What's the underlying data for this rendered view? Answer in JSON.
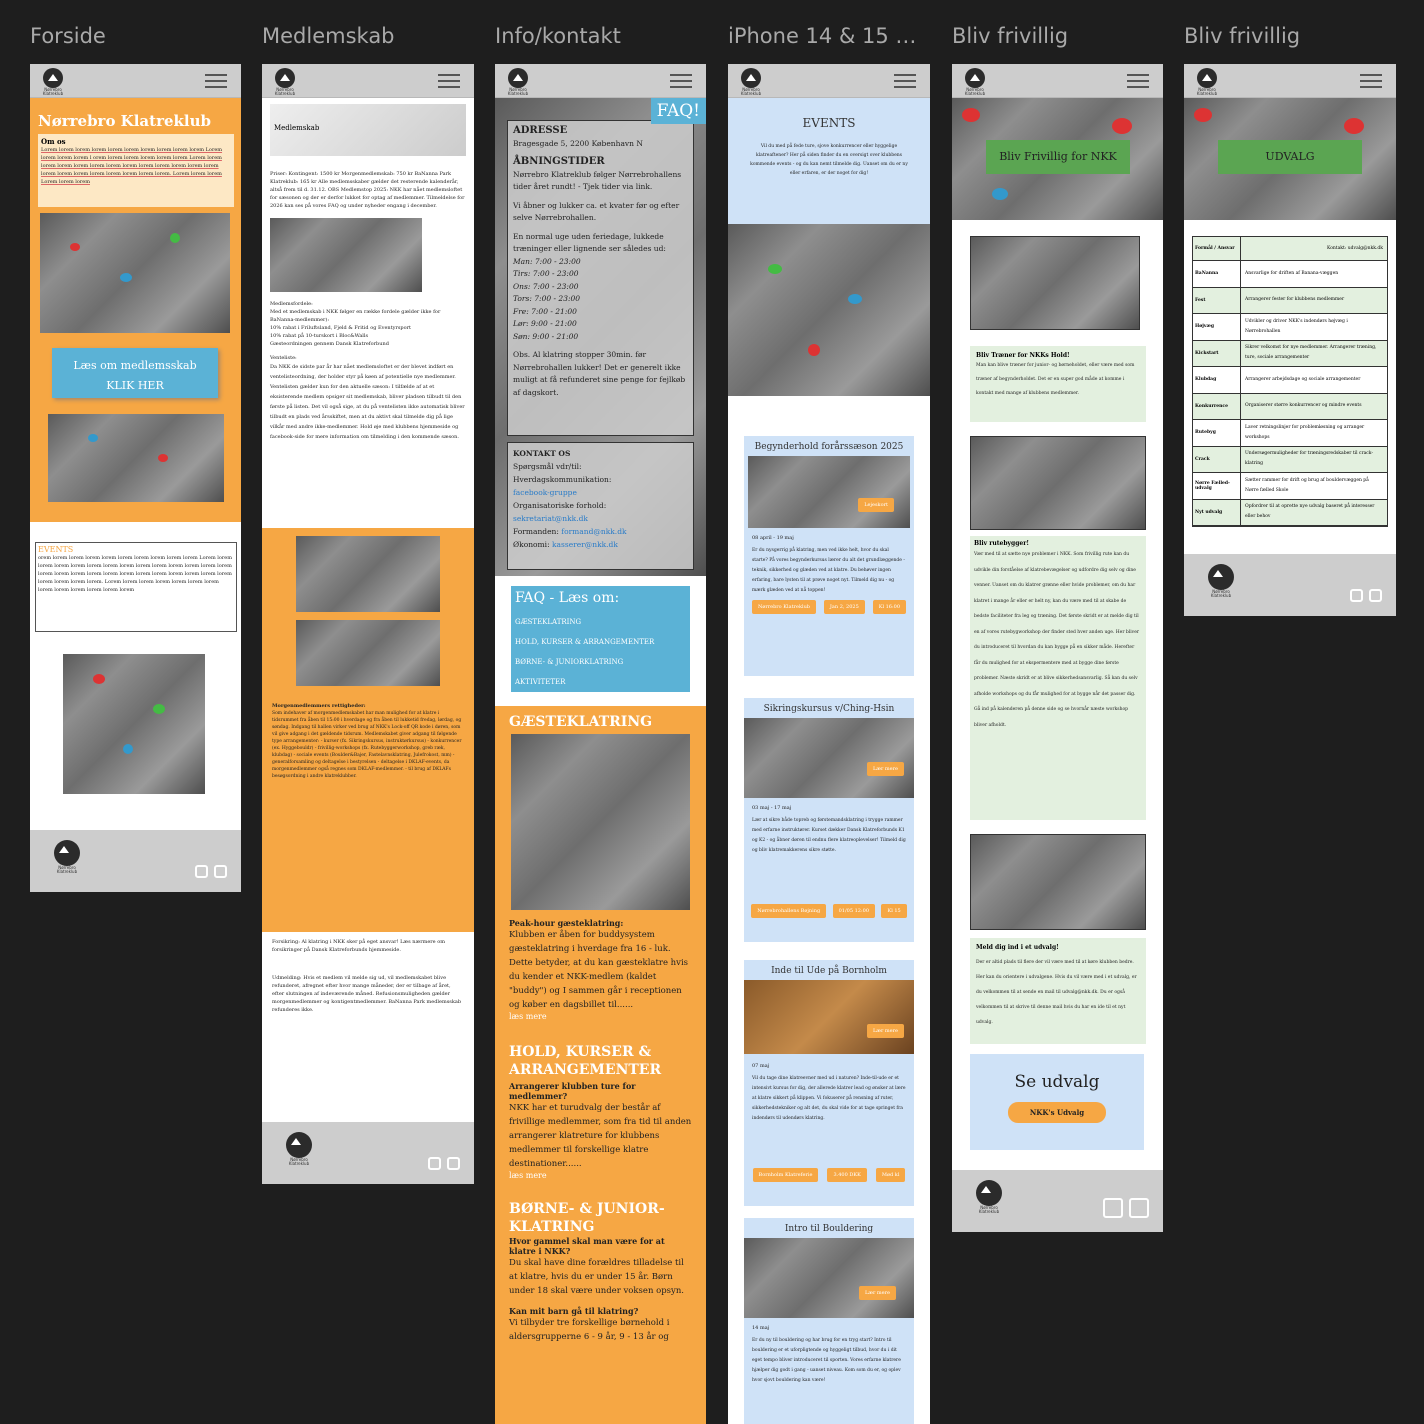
{
  "frames": [
    {
      "title": "Forside"
    },
    {
      "title": "Medlemskab"
    },
    {
      "title": "Info/kontakt"
    },
    {
      "title": "iPhone 14 & 15 P..."
    },
    {
      "title": "Bliv frivillig"
    },
    {
      "title": "Bliv frivillig"
    }
  ],
  "common": {
    "logo_text": "Nørrebro Klatreklub"
  },
  "forside": {
    "club_name": "Nørrebro Klatreklub",
    "about_title": "Om os",
    "about_text": "Lorem lorem lorem lorem lorem lorem lorem lorem lorem lorem Lorem lorem lorem lorem l orem lorem lorem lorem  lorem lorem Lorem lorem lorem lorem lorem lorem lorem lorem lorem lorem lorem lorem lorem lorem lorem lorem lorem lorem lorem lorem lorem. Lorem lorem lorem Lorem lorem lorem",
    "cta_line1": "Læs om medlemsskab",
    "cta_line2": "KLIK HER",
    "events_title": "EVENTS",
    "events_text": "orem lorem lorem lorem lorem lorem lorem lorem lorem lorem Lorem lorem lorem lorem lorem lorem lorem lorem lorem lorem lorem lorem lorem lorem lorem lorem lorem lorem lorem lorem lorem lorem lorem lorem lorem lorem lorem lorem lorem lorem. Lorem lorem lorem lorem lorem lorem lorem lorem lorem lorem lorem lorem lorem"
  },
  "medlemskab": {
    "hero_label": "Medlemskab",
    "prices_text": "Priser: Kontingent: 1500 kr Morgenmedlemskab: 750 kr BaNanna Park Klatreklub: 165 kr Alle medlemsskaber gælder det resterende kalenderår, altså frem til d. 31.12. OBS Medlemstop 2025: NKK har nået medlemsloftet for sæsonen og der er derfor lukket for optag af medlemmer. Tilmeldelse for 2026 kan ses på vores FAQ og under nyheder engang i december.",
    "benefits_title": "Medlemsfordele:",
    "benefits_intro": "Med et medlemskab i NKK følger en række fordele gælder ikke for BaNanna-medlemmer):",
    "benefits": [
      "10% rabat i Friluftsland, Fjeld & Fritid og Eventyrsport",
      "10% rabat på 10-turskort i Bloc&Walls",
      "Gæsteordningen gennem Dansk Klatreforbund"
    ],
    "waitlist_title": "Venteliste:",
    "waitlist_text": "Da NKK de sidste par år har nået medlemsloftet er der blevet indført en ventelisteordning, der holder styr på køen af potentielle nye medlemmer. Ventelisten gælder kun for den aktuelle sæson: I tilfælde af at et eksisterende medlem opsiger sit medlemskab, bliver pladsen tilbudt til den første på listen. Det vil også sige, at du på ventelisten ikke automatisk bliver tilbudt en plads ved årsskiftet, men at du aktivt skal tilmelde dig på lige vilkår med andre ikke-medlemmer. Hold øje med klubbens hjemmeside og facebook-side for mere information om tilmelding i den kommende sæson.",
    "morning_title": "Morgenmedlemmers rettigheder:",
    "morning_text": "Som indehaver af morgenmedlemskabet har man mulighed for at klatre i tidsrummet fra åben til 15:00 i hverdage og fra åben til lukketid fredag, lørdag, og søndag. Indgang til hallen virker ved brug af NKK's Lock-off QR kode i døren, som vil give adgang i det gældende tidsrum. Medlemskabet giver adgang til følgende type arrangementer: - kurser (fx. Sikringskursus, instruktørkursus) - konkurrencer (ex. Hyggebouldr) - frivillig-workshops (fx. Rutebyggerworkshop, greb ræk, klubdag) - sociale events (Boulder&Bajer, Fastelavnsklatring, Julefrokost, mm) - generalforsamling og deltagelse i bestyrelsen - deltagelse i DKLAF-events, da morgenmedlemmer også regnes som DKLAF-medlemmer. - til brug af DKLAFs besøgsordning i andre klatreklubber.",
    "insurance_text": "Forsikring: Al klatring i NKK sker på eget ansvar! Læs nærmere om forsikringer på Dansk Klatreforbunds hjemmeside.",
    "leave_text": "Udmelding: Hvis et medlem vil melde sig ud, vil medlemskabet blive refunderet, afregnet efter hvor mange måneder, der er tilbage af året, efter slutningen af indeværende måned. Refusionsmuligheden gælder morgenmedlemmer og kontigentmedlemmer. BaNanna Park medlemsskab refunderes ikke."
  },
  "info": {
    "faq_badge": "FAQ!",
    "address_title": "ADRESSE",
    "address": "Bragesgade 5, 2200 København N",
    "hours_title": "ÅBNINGSTIDER",
    "hours_intro": "Nørrebro Klatreklub følger Nørrebrohallens tider året rundt! - Tjek tider via link.",
    "hours_note": "Vi åbner og lukker ca. et kvater før og efter selve Nørrebrohallen.",
    "hours_normal": "En normal uge uden feriedage, lukkede træninger eller lignende ser således ud:",
    "schedule": [
      "Man: 7:00 - 23:00",
      "Tirs: 7:00 - 23:00",
      "Ons: 7:00 - 23:00",
      "Tors: 7:00 - 23:00",
      "Fre: 7:00 - 21:00",
      "Lør: 9:00 - 21:00",
      "Søn: 9:00 - 21:00"
    ],
    "hours_obs": "Obs. Al klatring stopper 30min. før Nørrebrohallen lukker! Det er generelt ikke muligt at få refunderet sine penge for fejlkøb af dagskort.",
    "contact_title": "KONTAKT OS",
    "contact_q": "Spørgsmål vdr/til:",
    "contact_daily": "Hverdagskommunikation:",
    "contact_fb": "facebook-gruppe",
    "contact_org": "Organisatoriske forhold:",
    "contact_mail": "sekretariat@nkk.dk",
    "contact_chair": "Formanden:",
    "contact_chair_mail": "formand@nkk.dk",
    "contact_econ": "Økonomi:",
    "contact_econ_mail": "kasserer@nkk.dk",
    "faq_title": "FAQ - Læs om:",
    "faq_links": [
      "GÆSTEKLATRING",
      "HOLD, KURSER & ARRANGEMENTER",
      "BØRNE- & JUNIORKLATRING",
      "AKTIVITETER"
    ],
    "guest_title": "GÆSTEKLATRING",
    "guest_sub": "Peak-hour gæsteklatring:",
    "guest_text": "Klubben er åben for buddysystem gæsteklatring i hverdage fra 16 - luk. Dette betyder, at du kan gæsteklatre hvis du kender et NKK-medlem (kaldet \"buddy\") og I sammen går i receptionen og køber en dagsbillet til......",
    "read_more": "læs mere",
    "courses_title": "HOLD, KURSER & ARRANGEMENTER",
    "courses_sub": "Arrangerer klubben ture for medlemmer?",
    "courses_text": "NKK har et turudvalg der består af frivillige medlemmer, som fra tid til anden arrangerer klatreture for klubbens medlemmer til forskellige klatre destinationer......",
    "kids_title": "BØRNE- & JUNIOR-KLATRING",
    "kids_sub": "Hvor gammel skal man være for at klatre i NKK?",
    "kids_text": "Du skal have dine forældres tilladelse til at klatre, hvis du er under 15 år. Børn under 18 skal være under voksen opsyn.",
    "kids_sub2": "Kan mit barn gå til klatring?",
    "kids_text2": "Vi tilbyder tre forskellige børnehold i aldersgrupperne 6 - 9 år, 9 - 13 år og"
  },
  "events": {
    "title": "EVENTS",
    "intro": "Vil du med på fede ture, sjove konkurrencer eller hyggelige klatreaftener? Her på siden finder du en oversigt over klubbens kommende events - og du kan nemt tilmelde dig. Uanset om du er ny eller erfaren, er der noget for dig!",
    "cards": [
      {
        "title": "Begynderhold forårssæson 2025",
        "date": "08 april - 19 maj",
        "text": "Er du nysgerrig på klatring, men ved ikke helt, hvor du skal starte? På vores begynderkursus lærer du alt det grundlæggende - teknik, sikkerhed og glæden ved at klatre. Du behøver ingen erfaring, bare lysten til at prøve noget nyt. Tilmeld dig nu - og mærk glæden ved at nå toppen!",
        "tag": "Lejeskort",
        "buttons": [
          "Nørrebro Klatreklub",
          "Jan 2, 2025",
          "Kl 16:00"
        ]
      },
      {
        "title": "Sikringskursus v/Ching-Hsin",
        "date": "03 maj - 17 maj",
        "text": "Lær at sikre både topreb og førstemandsklatring i trygge rammer med erfarne instruktører. Kurset dækker Dansk Klatreforbunds K1 og K2 - og åbner døren til endnu flere klatreoplevelser! Tilmeld dig og bliv klatremakkerens sikre støtte.",
        "tag": "Lær mere",
        "buttons": [
          "Nørrebrohallens Bøjning",
          "01/05 12:00",
          "Kl 15"
        ]
      },
      {
        "title": "Inde til Ude på Bornholm",
        "date": "07 maj",
        "text": "Vil du tage dine klatreevner med ud i naturen? Inde-til-ude er et intensivt kursus for dig, der allerede klatrer lead og ønsker at lære at klatre sikkert på klippen. Vi fokuserer på rensning af ruter, sikkerhedstekniker og alt det, du skal vide for at tage springet fra indendørs til udendørs klatring.",
        "tag": "Lær mere",
        "buttons": [
          "Bornholm Klatreferie",
          "3.400 DKK",
          "Mød kl"
        ]
      },
      {
        "title": "Intro til Bouldering",
        "date": "14 maj",
        "text": "Er du ny til bouldering og har brug for en tryg start? Intro til bouldering er et uforpligtende og hyggeligt tilbud, hvor du i dit eget tempo bliver introduceret til sporten. Vores erfarne klatrere hjælper dig godt i gang - uanset niveau. Kom som du er, og oplev hvor sjovt bouldering kan være!",
        "tag": "Lær mere",
        "buttons": []
      }
    ]
  },
  "frivillig1": {
    "hero_title": "Bliv Frivillig for NKK",
    "sec1_title": "Bliv Træner for NKKs Hold!",
    "sec1_text": "Man kan blive træner for junior- og børneholdet, eller være med som træner af begynderholdet. Det er en super god måde at komme i kontakt med mange af klubbens medlemmer.",
    "sec2_title": "Bliv rutebygger!",
    "sec2_text": "Vær med til at sætte nye problemer i NKK. Som frivillig rute kan du udvikle din forståelse af klatrebevægelser og udfordre dig selv og dine venner. Uanset om du klatrer grønne eller hvide problemer, om du har klatret i mange år eller er helt ny, kan du være med til at skabe de bedste faciliteter fra leg og træning. Det første skridt er at melde dig til en af vores rutebygworkshop der finder sted hver anden uge. Her bliver du introduceret til hvordan du kan bygge på en sikker måde. Herefter får du mulighed for at ekspermentere med at bygge dine første problemer. Næste skridt er at blive sikkerhedsansvarlig. Så kan du selv afholde workshops og du får mulighed for at bygge når det passer dig. Gå ind på kalenderen på denne side og se hvornår næste workshop bliver afholdt.",
    "sec3_title": "Meld dig ind i et udvalg!",
    "sec3_text": "Der er altid plads til flere der vil være med til at køre klubben bedre. Her kan du orientere i udvalgene. Hvis du vil være med i et udvalg, er du velkommen til at sende en mail til udvalg@nkk.dk. Du er også velkommen til at skrive til denne mail hvis du har en ide til et nyt udvalg.",
    "cta_title": "Se udvalg",
    "cta_button": "NKK's Udvalg"
  },
  "frivillig2": {
    "hero_title": "UDVALG",
    "table_headers": [
      "Formål / Ansvar",
      "Kontakt: udvalg@nkk.dk"
    ],
    "rows": [
      [
        "BaNanna",
        "Ansvarlige for driften af Banana-væggen"
      ],
      [
        "Fest",
        "Arrangerer fester for klubbens medlemmer"
      ],
      [
        "Højvæg",
        "Udvikler og driver NKK's indendørs højvæg i Nørrebrohallen"
      ],
      [
        "Kickstart",
        "Sikrer velkomst for nye medlemmer. Arrangerer træning, ture, sociale arrangementer"
      ],
      [
        "Klubdag",
        "Arrangerer arbejdsdage og sociale arrangementer"
      ],
      [
        "Konkurrence",
        "Organiserer større konkurrencer og mindre events"
      ],
      [
        "Rutebyg",
        "Laver retningslinjer for problemløsning og arranger workshops"
      ],
      [
        "Crack",
        "Undersøgermuligheder for træningsredskaber til crack-klatring"
      ],
      [
        "Nørre Fælled-udvalg",
        "Sætter rammer for drift og brug af bouldervæggen på Nørre fælled Skole"
      ],
      [
        "Nyt udvalg",
        "Opfordrer til at oprette nye udvalg baseret på interesser eller behov"
      ]
    ]
  }
}
